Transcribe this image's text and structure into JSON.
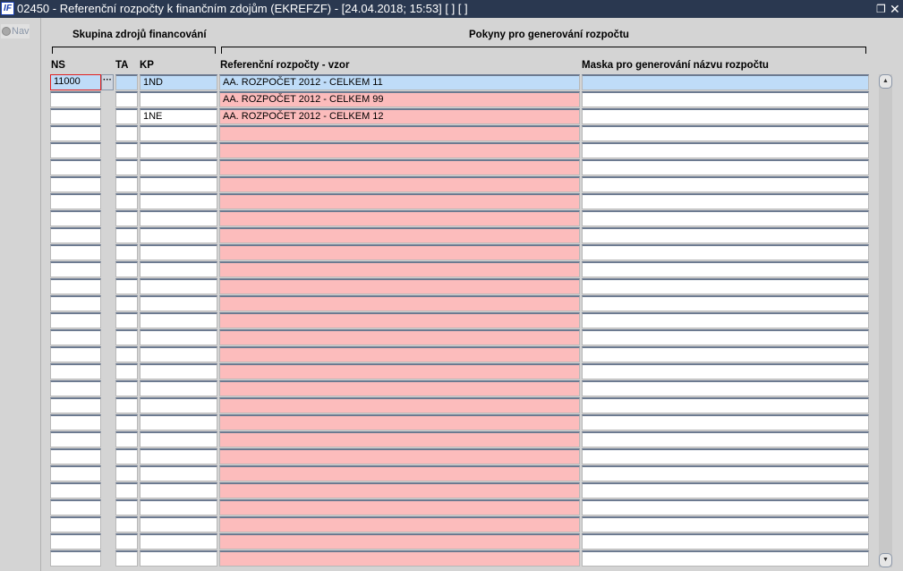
{
  "window": {
    "title": "02450 - Referenční rozpočty k finančním zdojům (EKREFZF) - [24.04.2018; 15:53]  [ ]  [ ]",
    "logo": "IF",
    "restore_icon": "restore-icon",
    "close_icon": "close-icon"
  },
  "nav": {
    "label": "Nav"
  },
  "groups": {
    "left": "Skupina zdrojů financování",
    "right": "Pokyny pro generování rozpočtu"
  },
  "columns": {
    "ns": "NS",
    "ta": "TA",
    "kp": "KP",
    "ref": "Referenční rozpočty - vzor",
    "mask": "Maska pro generování názvu rozpočtu"
  },
  "lov_label": "···",
  "rows": [
    {
      "ns": "11000",
      "ta": "",
      "kp": "1ND",
      "ref": "AA. ROZPOČET 2012 - CELKEM 11",
      "mask": ""
    },
    {
      "ns": "",
      "ta": "",
      "kp": "",
      "ref": "AA. ROZPOČET 2012 - CELKEM 99",
      "mask": ""
    },
    {
      "ns": "",
      "ta": "",
      "kp": "1NE",
      "ref": "AA. ROZPOČET 2012 - CELKEM 12",
      "mask": ""
    }
  ],
  "total_rows": 29,
  "colors": {
    "titlebar": "#2a3850",
    "selected": "#bfdcf8",
    "required": "#fcbcbc"
  }
}
